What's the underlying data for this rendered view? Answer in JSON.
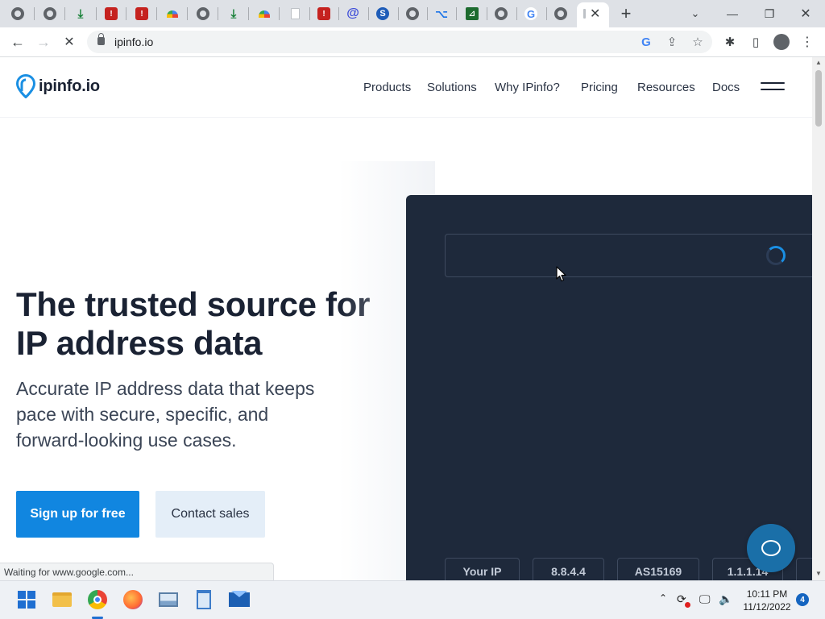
{
  "browser": {
    "tabs": [
      {
        "icon": "globe-icon"
      },
      {
        "icon": "globe-icon"
      },
      {
        "icon": "download-icon"
      },
      {
        "icon": "red-shield-icon"
      },
      {
        "icon": "red-shield-icon"
      },
      {
        "icon": "multicolor-icon"
      },
      {
        "icon": "globe-icon"
      },
      {
        "icon": "download-icon"
      },
      {
        "icon": "multicolor-icon"
      },
      {
        "icon": "document-icon"
      },
      {
        "icon": "red-shield-icon"
      },
      {
        "icon": "at-sign-icon"
      },
      {
        "icon": "s-logo-icon"
      },
      {
        "icon": "globe-icon"
      },
      {
        "icon": "code-icon"
      },
      {
        "icon": "dark-app-icon"
      },
      {
        "icon": "chrome-icon"
      },
      {
        "icon": "google-icon"
      },
      {
        "icon": "globe-icon"
      }
    ],
    "new_tab_label": "+",
    "url": "ipinfo.io",
    "status_text": "Waiting for www.google.com..."
  },
  "site": {
    "logo_text": "ipinfo.io",
    "nav": [
      "Products",
      "Solutions",
      "Why IPinfo?",
      "Pricing",
      "Resources",
      "Docs"
    ],
    "hero_title": "The trusted source for IP address data",
    "hero_subtitle": "Accurate IP address data that keeps pace with secure, specific, and forward-looking use cases.",
    "signup_label": "Sign up for free",
    "contact_label": "Contact sales",
    "chips": [
      "Your IP",
      "8.8.4.4",
      "AS15169",
      "1.1.1.14"
    ]
  },
  "taskbar": {
    "time": "10:11 PM",
    "date": "11/12/2022",
    "notifications": "4"
  },
  "colors": {
    "accent": "#1186e0",
    "panel": "#1e293b",
    "chat": "#1a6fa8"
  }
}
